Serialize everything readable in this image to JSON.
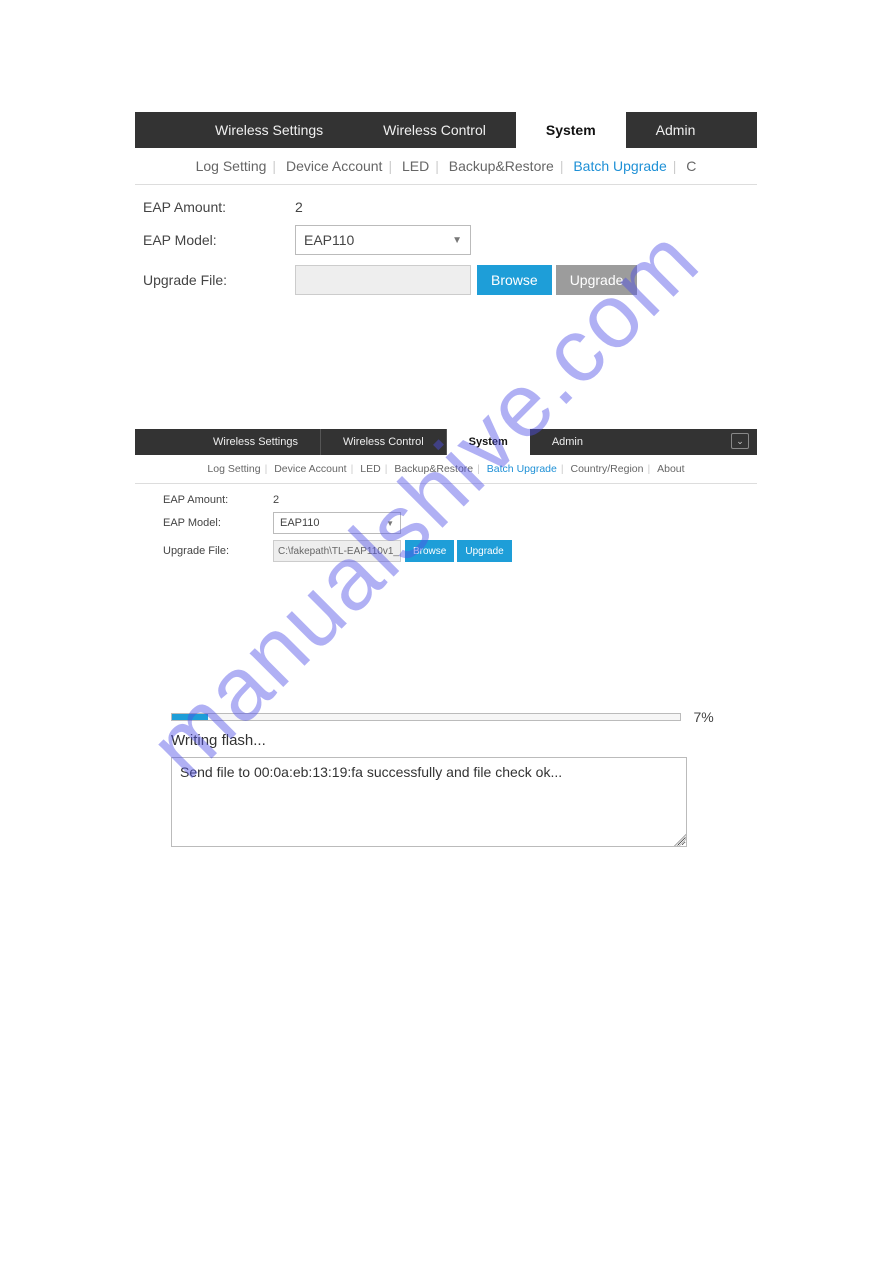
{
  "watermark_text": "manualshive.com",
  "screenshot1": {
    "main_tabs": [
      {
        "label": "Wireless Settings",
        "active": false
      },
      {
        "label": "Wireless Control",
        "active": false
      },
      {
        "label": "System",
        "active": true
      },
      {
        "label": "Admin",
        "active": false
      }
    ],
    "sub_tabs": [
      {
        "label": "Log Setting",
        "active": false
      },
      {
        "label": "Device Account",
        "active": false
      },
      {
        "label": "LED",
        "active": false
      },
      {
        "label": "Backup&Restore",
        "active": false
      },
      {
        "label": "Batch Upgrade",
        "active": true
      },
      {
        "label": "C",
        "active": false
      }
    ],
    "form": {
      "eap_amount_label": "EAP Amount:",
      "eap_amount_value": "2",
      "eap_model_label": "EAP Model:",
      "eap_model_value": "EAP110",
      "upgrade_file_label": "Upgrade File:",
      "upgrade_file_value": "",
      "browse_btn": "Browse",
      "upgrade_btn": "Upgrade"
    }
  },
  "screenshot2": {
    "main_tabs": [
      {
        "label": "Wireless Settings",
        "active": false
      },
      {
        "label": "Wireless Control",
        "active": false
      },
      {
        "label": "System",
        "active": true
      },
      {
        "label": "Admin",
        "active": false
      }
    ],
    "sub_tabs": [
      {
        "label": "Log Setting",
        "active": false
      },
      {
        "label": "Device Account",
        "active": false
      },
      {
        "label": "LED",
        "active": false
      },
      {
        "label": "Backup&Restore",
        "active": false
      },
      {
        "label": "Batch Upgrade",
        "active": true
      },
      {
        "label": "Country/Region",
        "active": false
      },
      {
        "label": "About",
        "active": false
      }
    ],
    "form": {
      "eap_amount_label": "EAP Amount:",
      "eap_amount_value": "2",
      "eap_model_label": "EAP Model:",
      "eap_model_value": "EAP110",
      "upgrade_file_label": "Upgrade File:",
      "upgrade_file_value": "C:\\fakepath\\TL-EAP110v1_",
      "browse_btn": "Browse",
      "upgrade_btn": "Upgrade"
    }
  },
  "progress": {
    "percent_text": "7%",
    "percent_value": 7,
    "status_text": "Writing flash...",
    "log_text": "Send file to 00:0a:eb:13:19:fa successfully and file check ok..."
  }
}
